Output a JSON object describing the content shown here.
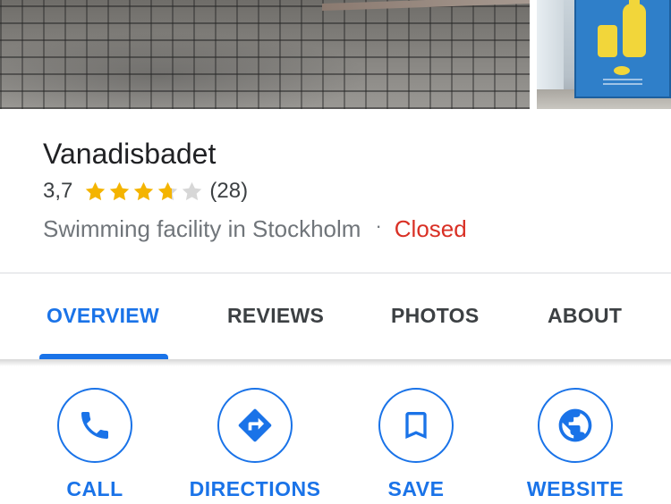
{
  "place": {
    "name": "Vanadisbadet",
    "rating": "3,7",
    "rating_value": 3.7,
    "max_stars": 5,
    "review_count": "(28)",
    "category": "Swimming facility in Stockholm",
    "separator": "·",
    "status": "Closed"
  },
  "tabs": [
    {
      "label": "OVERVIEW",
      "active": true
    },
    {
      "label": "REVIEWS",
      "active": false
    },
    {
      "label": "PHOTOS",
      "active": false
    },
    {
      "label": "ABOUT",
      "active": false
    }
  ],
  "actions": [
    {
      "label": "CALL",
      "icon": "phone-icon"
    },
    {
      "label": "DIRECTIONS",
      "icon": "directions-icon"
    },
    {
      "label": "SAVE",
      "icon": "bookmark-icon"
    },
    {
      "label": "WEBSITE",
      "icon": "globe-icon"
    }
  ],
  "colors": {
    "accent": "#1a73e8",
    "star": "#f4b400",
    "star_empty": "#d7d7d7",
    "closed": "#d93025",
    "text_primary": "#202124",
    "text_secondary": "#70757a"
  }
}
